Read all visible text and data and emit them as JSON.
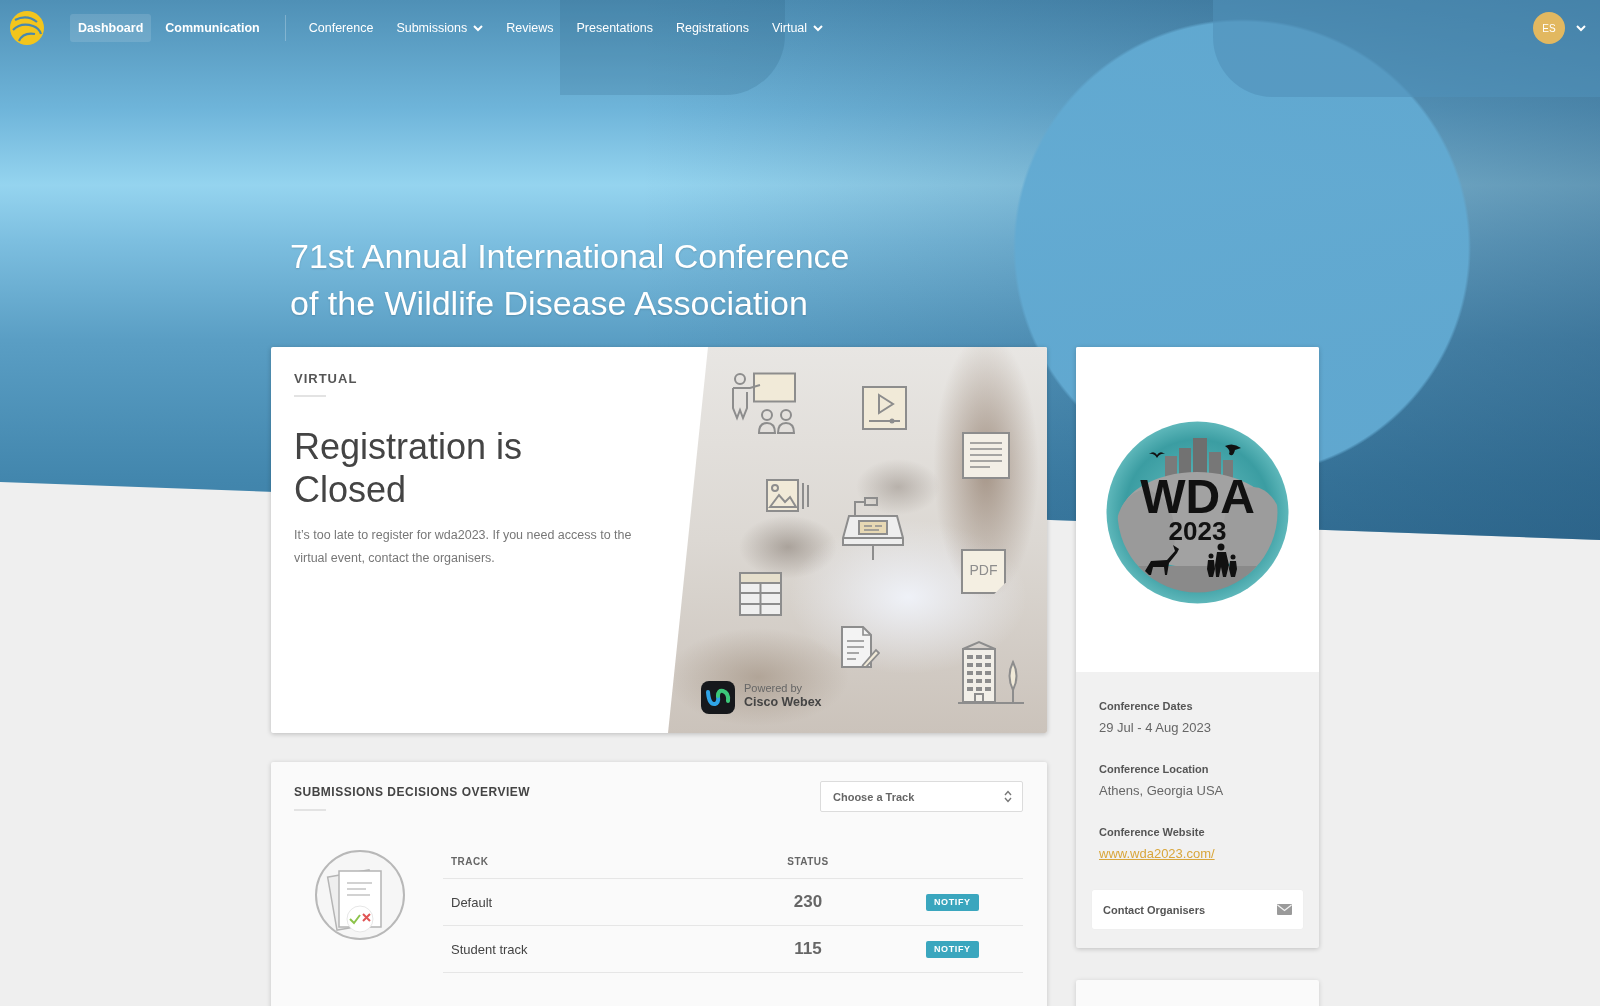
{
  "nav": {
    "main": [
      {
        "label": "Dashboard",
        "selected": true
      },
      {
        "label": "Communication",
        "selected": false
      }
    ],
    "sections": [
      {
        "label": "Conference",
        "kind": "link",
        "selected": false
      },
      {
        "label": "Submissions",
        "kind": "dropdown",
        "selected": false
      },
      {
        "label": "Reviews",
        "kind": "link",
        "selected": false
      },
      {
        "label": "Presentations",
        "kind": "link",
        "selected": false
      },
      {
        "label": "Registrations",
        "kind": "link",
        "selected": false
      },
      {
        "label": "Virtual",
        "kind": "dropdown",
        "selected": false
      }
    ],
    "user": {
      "initials": "ES"
    }
  },
  "hero": {
    "title": "71st Annual International Conference of the Wildlife Disease Association"
  },
  "virtual_card": {
    "label": "VIRTUAL",
    "heading": "Registration is Closed",
    "message": "It’s too late to register for wda2023. If you need access to the virtual event, contact the organisers.",
    "banner": {
      "pdf_label": "PDF",
      "powered_by": "Powered by",
      "provider": "Cisco Webex"
    }
  },
  "conference_card": {
    "logo": {
      "title": "WDA",
      "year": "2023"
    },
    "details": [
      {
        "label": "Conference Dates",
        "value": "29 Jul - 4 Aug 2023",
        "kind": "text"
      },
      {
        "label": "Conference Location",
        "value": "Athens, Georgia USA",
        "kind": "text"
      },
      {
        "label": "Conference Website",
        "value": "www.wda2023.com/",
        "kind": "link"
      }
    ],
    "contact_button": "Contact Organisers"
  },
  "submissions_overview": {
    "title": "SUBMISSIONS DECISIONS OVERVIEW",
    "track_select": {
      "placeholder": "Choose a Track"
    },
    "columns": [
      "TRACK",
      "STATUS"
    ],
    "rows": [
      {
        "track": "Default",
        "status": "230",
        "notify_button": "NOTIFY"
      },
      {
        "track": "Student track",
        "status": "115",
        "notify_button": "NOTIFY"
      }
    ]
  }
}
